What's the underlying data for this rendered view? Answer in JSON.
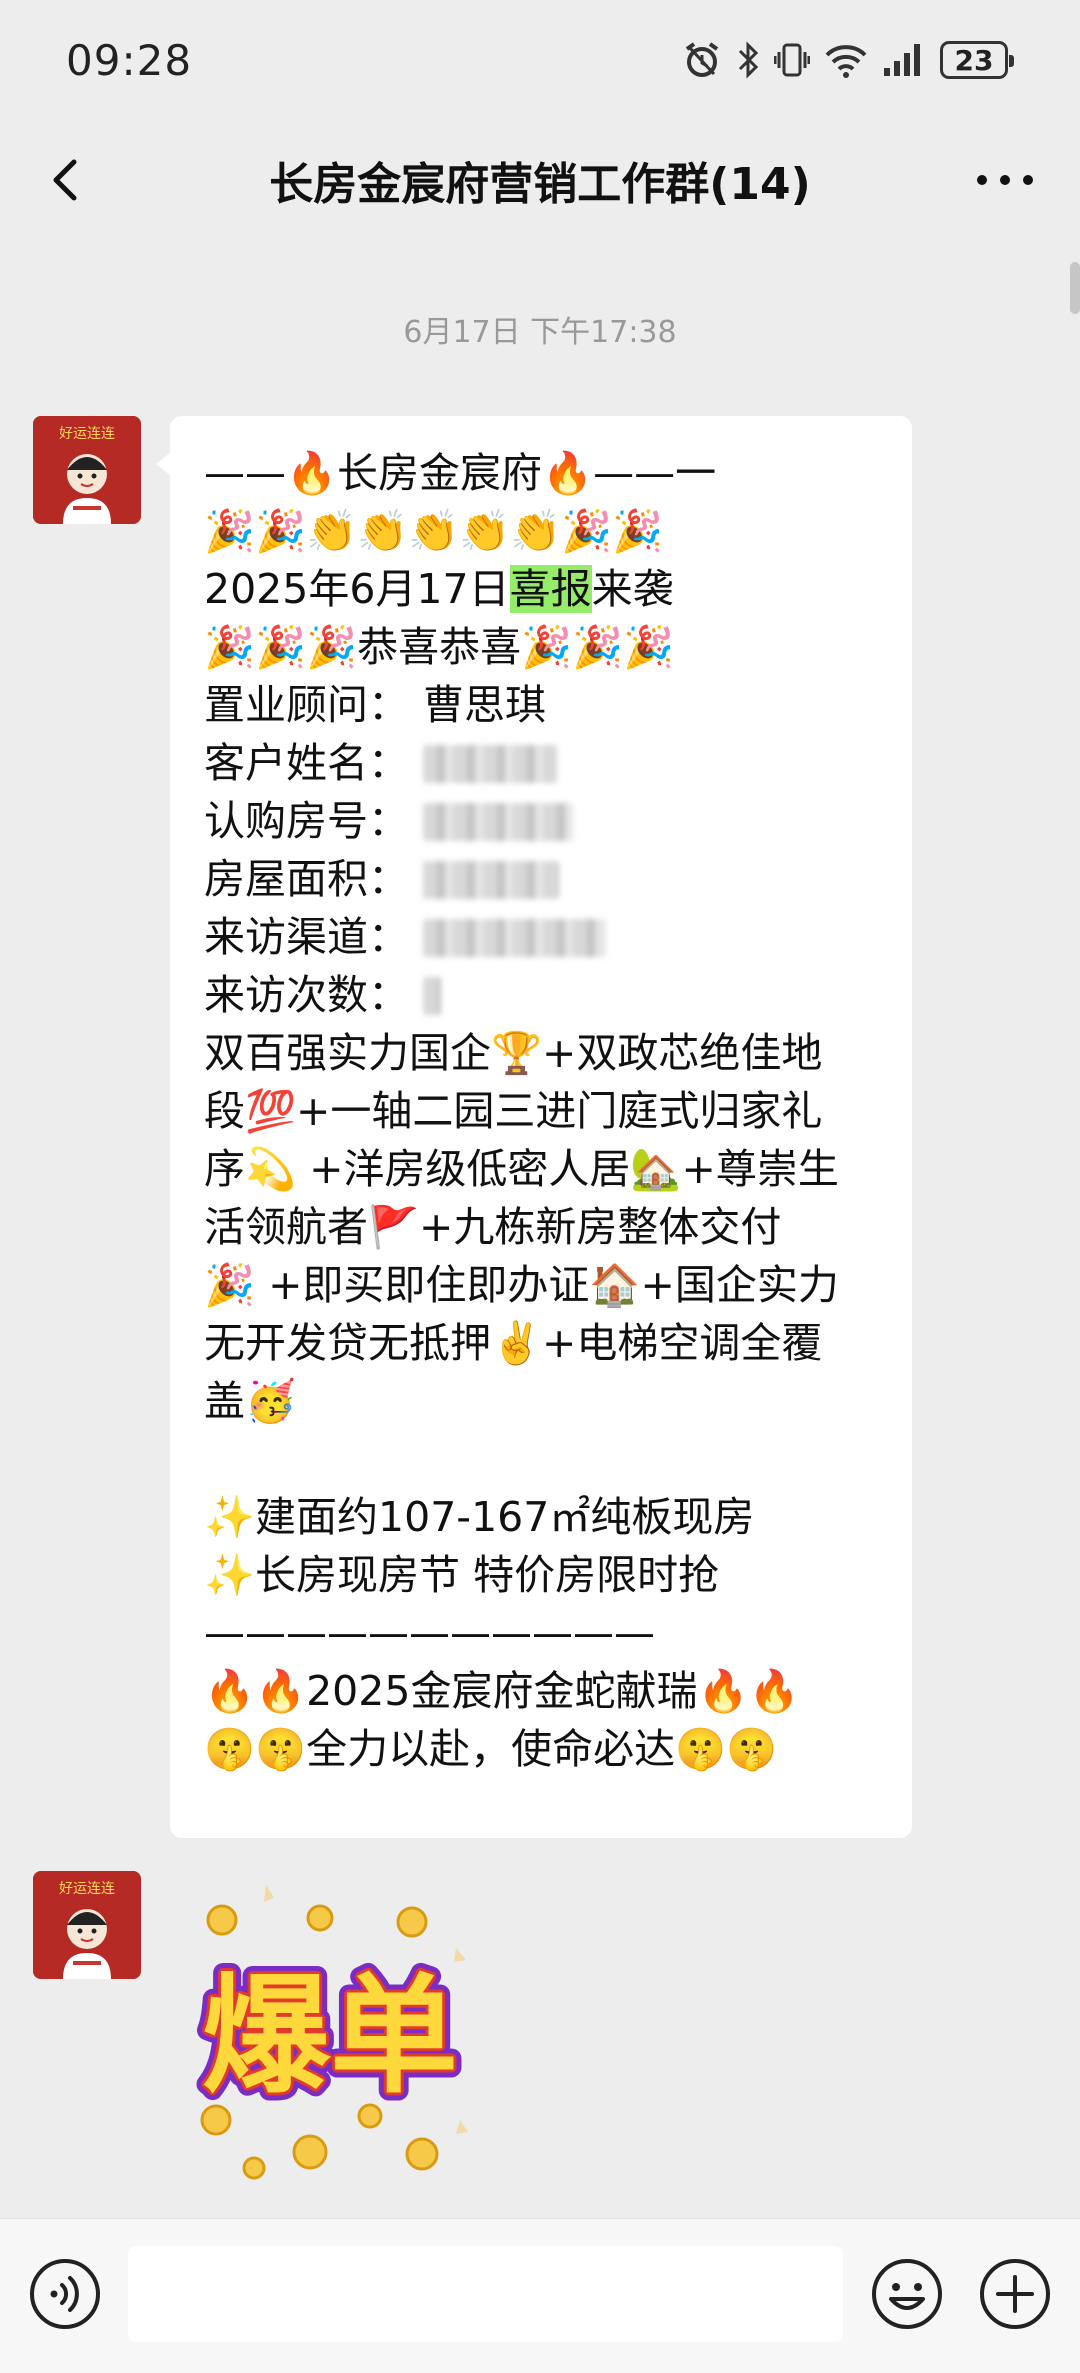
{
  "status_bar": {
    "time": "09:28",
    "battery_level": "23",
    "icons": [
      "alarm-icon",
      "bluetooth-icon",
      "vibrate-icon",
      "wifi-icon",
      "signal-icon",
      "battery-icon"
    ]
  },
  "nav": {
    "title": "长房金宸府营销工作群(14)",
    "back_icon": "chevron-left-icon",
    "more_icon": "more-dots-icon"
  },
  "chat": {
    "timestamp": "6月17日 下午17:38",
    "message": {
      "header": "——🔥长房金宸府🔥——一",
      "emoji_row": "🎉🎉👏👏👏👏👏🎉🎉",
      "date_prefix": "2025年6月17日",
      "highlight": "喜报",
      "date_suffix": "来袭",
      "congrats": "🎉🎉🎉恭喜恭喜🎉🎉🎉",
      "fields": [
        {
          "label": "置业顾问：",
          "value": "曹思琪",
          "redacted": false
        },
        {
          "label": "客户姓名：",
          "value": "",
          "redacted": true
        },
        {
          "label": "认购房号：",
          "value": "",
          "redacted": true
        },
        {
          "label": "房屋面积：",
          "value": "",
          "redacted": true
        },
        {
          "label": "来访渠道：",
          "value": "",
          "redacted": true
        },
        {
          "label": "来访次数：",
          "value": "",
          "redacted": true
        }
      ],
      "body_lines": [
        "双百强实力国企🏆+双政芯绝佳地",
        "段💯+一轴二园三进门庭式归家礼",
        "序💫 +洋房级低密人居🏡+尊崇生",
        "活领航者🚩+九栋新房整体交付",
        "🎉 +即买即住即办证🏠+国企实力",
        "无开发贷无抵押✌️+电梯空调全覆",
        "盖🥳"
      ],
      "feature_1": "✨建面约107-167㎡纯板现房",
      "feature_2": "✨长房现房节 特价房限时抢",
      "divider": "———————————",
      "footer_1": "🔥🔥2025金宸府金蛇献瑞🔥🔥",
      "footer_2": "🤫🤫全力以赴，使命必达🤫🤫"
    },
    "sticker_text": "爆单",
    "avatar_text": "好运连连"
  },
  "input_bar": {
    "voice_icon": "voice-icon",
    "emoji_icon": "emoji-icon",
    "plus_icon": "plus-icon",
    "input_value": ""
  },
  "colors": {
    "background": "#ededed",
    "bubble": "#ffffff",
    "highlight": "#95ec69",
    "avatar": "#b52a24"
  }
}
